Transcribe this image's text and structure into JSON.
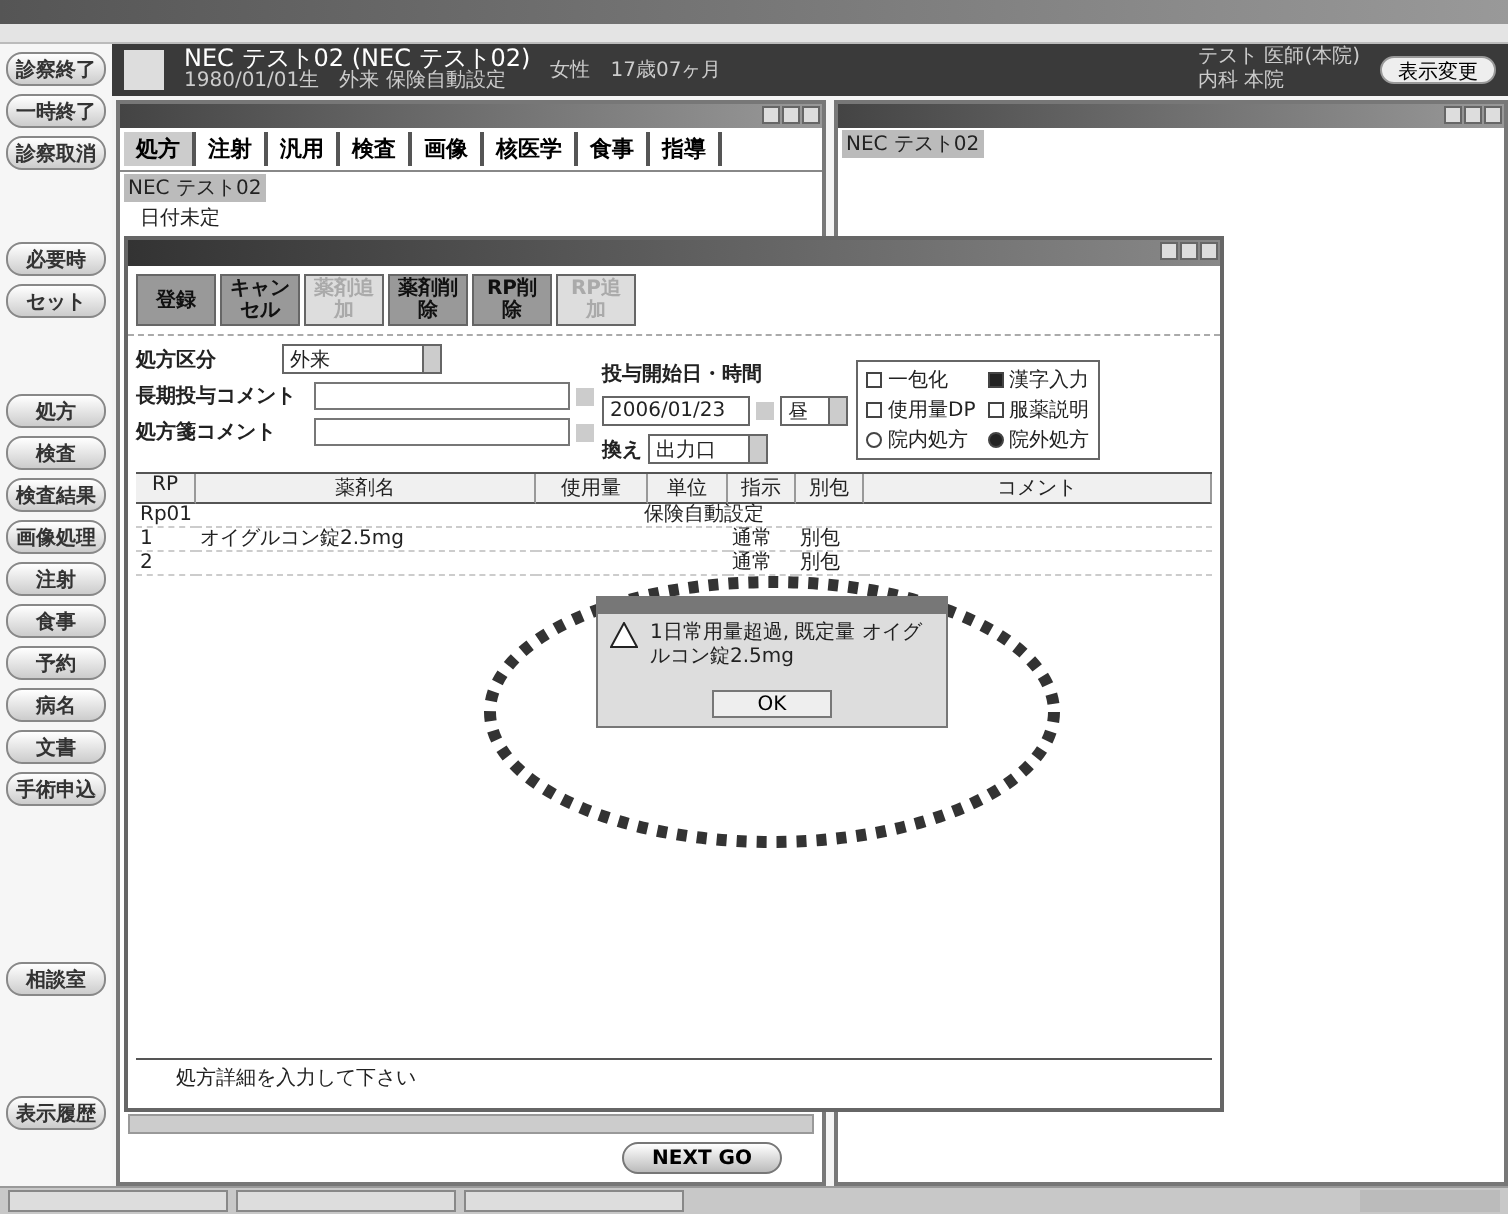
{
  "sidebar": {
    "top_buttons": [
      "診察終了",
      "一時終了",
      "診察取消"
    ],
    "mid_buttons": [
      "必要時",
      "セット"
    ],
    "menu_buttons": [
      "処方",
      "検査",
      "検査結果",
      "画像処理",
      "注射",
      "食事",
      "予約",
      "病名",
      "文書",
      "手術申込"
    ],
    "extra_button": "相談室",
    "bottom_button": "表示履歴"
  },
  "patient": {
    "name": "NEC テスト02 (NEC テスト02)",
    "details": "1980/01/01生　外来 保険自動設定",
    "sex_age": "女性　17歳07ヶ月",
    "doctor": "テスト 医師(本院)",
    "dept": "内科 本院",
    "button": "表示変更"
  },
  "order_window": {
    "tabs": [
      {
        "label": "処方",
        "selected": true
      },
      {
        "label": "注射",
        "selected": false
      },
      {
        "label": "汎用",
        "selected": false
      },
      {
        "label": "検査",
        "selected": false
      },
      {
        "label": "画像",
        "selected": false
      },
      {
        "label": "核医学",
        "selected": false
      },
      {
        "label": "食事",
        "selected": false
      },
      {
        "label": "指導",
        "selected": false
      }
    ],
    "patient_label": "NEC テスト02",
    "date_label": "日付未定",
    "next_button": "NEXT GO"
  },
  "viewer_window": {
    "patient_label": "NEC テスト02"
  },
  "prescription_dialog": {
    "toolbar": [
      {
        "label": "登録",
        "disabled": false
      },
      {
        "label": "キャンセル",
        "disabled": false
      },
      {
        "label": "薬剤追加",
        "disabled": true
      },
      {
        "label": "薬剤削除",
        "disabled": false
      },
      {
        "label": "RP削除",
        "disabled": false
      },
      {
        "label": "RP追加",
        "disabled": true
      }
    ],
    "type_label": "処方区分",
    "type_value": "外来",
    "long_comment_label": "長期投与コメント",
    "sheet_comment_label": "処方箋コメント",
    "start_label": "投与開始日・時間",
    "start_date": "2006/01/23",
    "start_time": "昼",
    "swap_label": "換え",
    "swap_value": "出力口",
    "options": [
      {
        "kind": "checkbox",
        "label": "一包化",
        "checked": false
      },
      {
        "kind": "checkbox",
        "label": "漢字入力",
        "checked": true
      },
      {
        "kind": "checkbox",
        "label": "使用量DP",
        "checked": false
      },
      {
        "kind": "checkbox",
        "label": "服薬説明",
        "checked": false
      },
      {
        "kind": "radio",
        "label": "院内処方",
        "selected": false
      },
      {
        "kind": "radio",
        "label": "院外処方",
        "selected": true
      }
    ],
    "columns": [
      "RP",
      "薬剤名",
      "使用量",
      "単位",
      "指示",
      "別包",
      "コメント"
    ],
    "rows": [
      {
        "kind": "group",
        "rp": "Rp01",
        "drug": "保険自動設定"
      },
      {
        "kind": "drug",
        "rp": "1",
        "drug": "オイグルコン錠2.5mg",
        "instruction": "通常",
        "separate": "別包"
      },
      {
        "kind": "drug",
        "rp": "2",
        "instruction": "通常",
        "separate": "別包"
      }
    ],
    "status": "処方詳細を入力して下さい"
  },
  "alert": {
    "message": "1日常用量超過, 既定量 オイグルコン錠2.5mg",
    "ok": "OK"
  }
}
